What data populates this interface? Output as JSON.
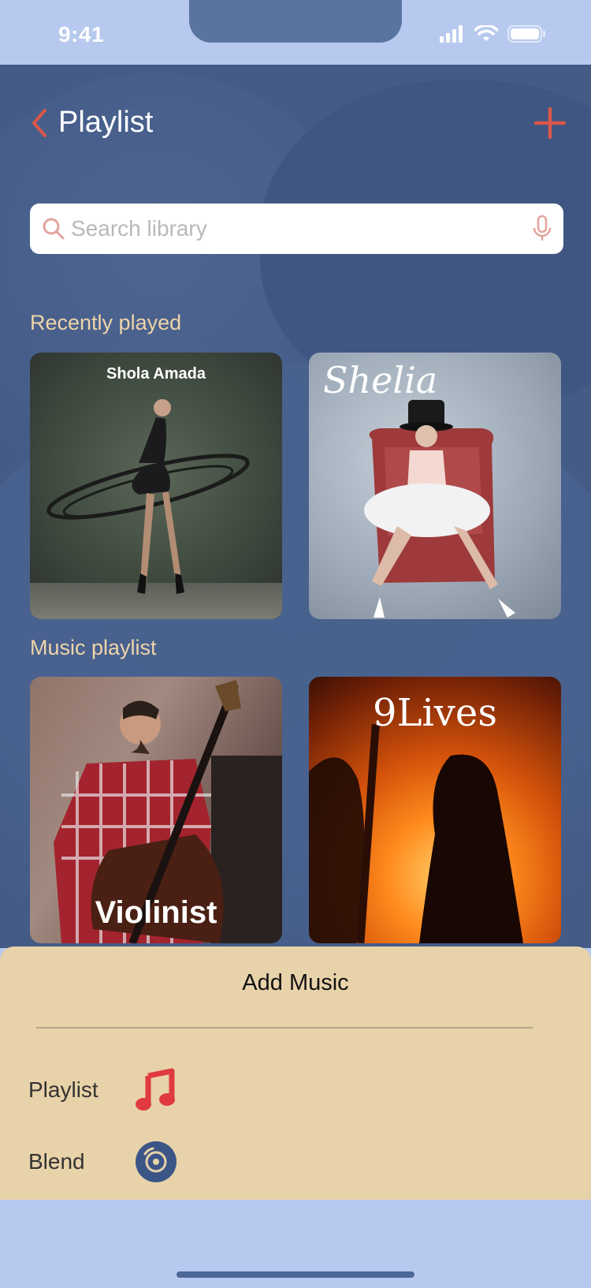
{
  "status_bar": {
    "time": "9:41",
    "icons": [
      "cellular-signal-icon",
      "wifi-icon",
      "battery-icon"
    ]
  },
  "header": {
    "title": "Playlist",
    "back_icon": "chevron-left-icon",
    "add_icon": "plus-icon"
  },
  "search": {
    "placeholder": "Search library",
    "value": "",
    "icon": "search-icon",
    "mic_icon": "microphone-icon"
  },
  "sections": {
    "recently_played": {
      "label": "Recently played",
      "cards": [
        {
          "caption": "Shola Amada"
        },
        {
          "caption": "Shelia"
        }
      ]
    },
    "music_playlist": {
      "label": "Music playlist",
      "cards": [
        {
          "caption": "Violinist"
        },
        {
          "caption": "9Lives"
        }
      ]
    }
  },
  "sheet": {
    "title": "Add Music",
    "options": [
      {
        "label": "Playlist",
        "icon": "music-note-icon"
      },
      {
        "label": "Blend",
        "icon": "vinyl-disc-icon"
      }
    ]
  },
  "colors": {
    "background": "#445b86",
    "accent": "#d9574a",
    "section_label": "#efd4aa",
    "sheet": "#e8d2a9",
    "status_bar": "#b7c9ef"
  }
}
